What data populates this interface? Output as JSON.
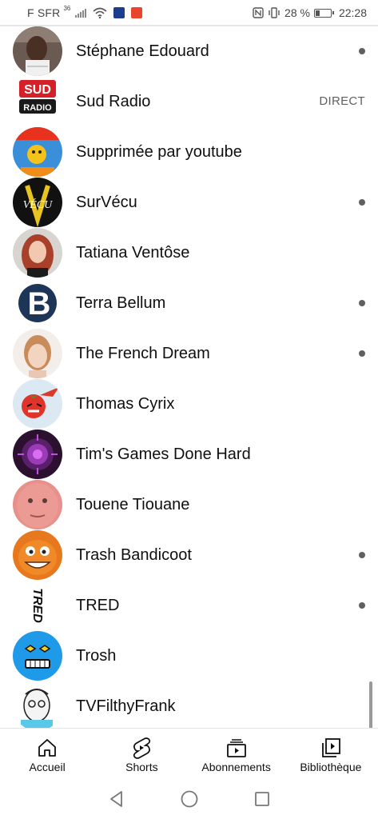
{
  "status_bar": {
    "carrier": "F SFR",
    "network": "36",
    "battery": "28 %",
    "battery_level": 0.28,
    "time": "22:28"
  },
  "channels": [
    {
      "name": "Stéphane Edouard",
      "indicator": "dot",
      "avatar_icon": "portrait-man-icon"
    },
    {
      "name": "Sud Radio",
      "indicator": "live",
      "live_label": "DIRECT",
      "avatar_icon": "sud-radio-logo"
    },
    {
      "name": "Supprimée par youtube",
      "indicator": "none",
      "avatar_icon": "cartoon-channel-icon"
    },
    {
      "name": "SurVécu",
      "indicator": "dot",
      "avatar_icon": "survecu-logo"
    },
    {
      "name": "Tatiana Ventôse",
      "indicator": "none",
      "avatar_icon": "portrait-woman-icon"
    },
    {
      "name": "Terra Bellum",
      "indicator": "dot",
      "avatar_icon": "terra-bellum-logo"
    },
    {
      "name": "The French Dream",
      "indicator": "dot",
      "avatar_icon": "portrait-woman-icon"
    },
    {
      "name": "Thomas Cyrix",
      "indicator": "none",
      "avatar_icon": "tomato-logo"
    },
    {
      "name": "Tim's Games Done Hard",
      "indicator": "none",
      "avatar_icon": "purple-emblem-logo"
    },
    {
      "name": "Touene Tiouane",
      "indicator": "none",
      "avatar_icon": "face-closeup-icon"
    },
    {
      "name": "Trash Bandicoot",
      "indicator": "dot",
      "avatar_icon": "bandicoot-cartoon-icon"
    },
    {
      "name": "TRED",
      "indicator": "dot",
      "avatar_icon": "tred-logo"
    },
    {
      "name": "Trosh",
      "indicator": "none",
      "avatar_icon": "blue-cartoon-face-icon"
    },
    {
      "name": "TVFilthyFrank",
      "indicator": "none",
      "avatar_icon": "sketch-face-icon"
    }
  ],
  "bottom_nav": [
    {
      "label": "Accueil",
      "icon": "home-icon"
    },
    {
      "label": "Shorts",
      "icon": "shorts-icon"
    },
    {
      "label": "Abonnements",
      "icon": "subscriptions-icon"
    },
    {
      "label": "Bibliothèque",
      "icon": "library-icon"
    }
  ],
  "system_nav": [
    {
      "icon": "back-icon"
    },
    {
      "icon": "home-circle-icon"
    },
    {
      "icon": "recents-icon"
    }
  ]
}
